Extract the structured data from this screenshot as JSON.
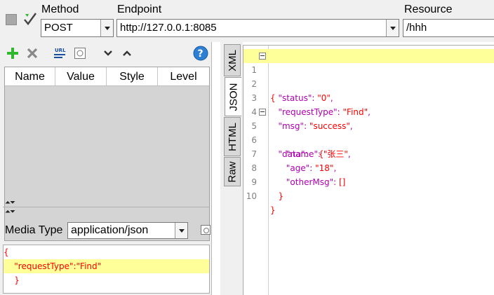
{
  "colors": {
    "json_key": "#b000b0",
    "json_string": "#ff0000",
    "json_brace": "#ff0000",
    "line_highlight": "#ffff99",
    "add_icon": "#2eb82e",
    "delete_icon": "#888888",
    "help_icon": "#2d7fd3"
  },
  "icons": {
    "status": "status-square-icon",
    "send": "send-check-icon",
    "add": "plus-icon",
    "delete": "x-icon",
    "url_encode": "url-encode-icon",
    "format": "format-icon",
    "move_down": "chevron-down-icon",
    "move_up": "chevron-up-icon",
    "help": "help-icon"
  },
  "request": {
    "method_label": "Method",
    "method_value": "POST",
    "endpoint_label": "Endpoint",
    "endpoint_value": "http://127.0.0.1:8085",
    "resource_label": "Resource",
    "resource_value": "/hhh"
  },
  "params": {
    "columns": [
      "Name",
      "Value",
      "Style",
      "Level"
    ]
  },
  "media_type": {
    "label": "Media Type",
    "value": "application/json"
  },
  "request_body": {
    "lines": [
      "{",
      "    \"requestType\":\"Find\"",
      "    }"
    ]
  },
  "response_tabs": [
    "XML",
    "JSON",
    "HTML",
    "Raw"
  ],
  "response": {
    "line_numbers": [
      "1",
      "2",
      "3",
      "4",
      "5",
      "6",
      "7",
      "8",
      "9",
      "10"
    ],
    "open_brace": "{",
    "close_brace": "}",
    "status_key": "\"status\"",
    "status_value": "\"0\"",
    "requestType_key": "\"requestType\"",
    "requestType_value": "\"Find\"",
    "msg_key": "\"msg\"",
    "msg_value": "\"success\"",
    "data_key": "\"data\"",
    "name_key": "\"name\"",
    "name_value": "\"张三\"",
    "age_key": "\"age\"",
    "age_value": "\"18\"",
    "otherMsg_key": "\"otherMsg\"",
    "otherMsg_value": "[]"
  }
}
